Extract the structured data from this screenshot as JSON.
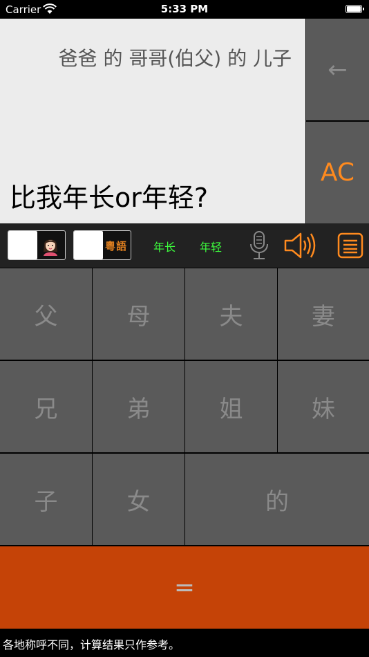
{
  "status_bar": {
    "carrier": "Carrier",
    "time": "5:33 PM"
  },
  "display": {
    "expression": "爸爸 的 哥哥(伯父) 的 儿子",
    "result": "比我年长or年轻?"
  },
  "buttons": {
    "backspace": "←",
    "clear": "AC",
    "equals": "="
  },
  "toolbar": {
    "cantonese_label": "粵語",
    "older": "年长",
    "younger": "年轻",
    "icons": [
      "female-avatar-icon",
      "microphone-icon",
      "speaker-icon",
      "list-icon"
    ]
  },
  "keypad": {
    "row1": [
      "父",
      "母",
      "夫",
      "妻"
    ],
    "row2": [
      "兄",
      "弟",
      "姐",
      "妹"
    ],
    "row3": [
      "子",
      "女",
      "的"
    ]
  },
  "footer": {
    "note": "各地称呼不同，计算结果只作参考。"
  },
  "colors": {
    "accent": "#ff8a1e",
    "equals_bg": "#c54307",
    "key_bg": "#5a5a5a",
    "age_text": "#3dff3d",
    "display_bg": "#ececec"
  }
}
